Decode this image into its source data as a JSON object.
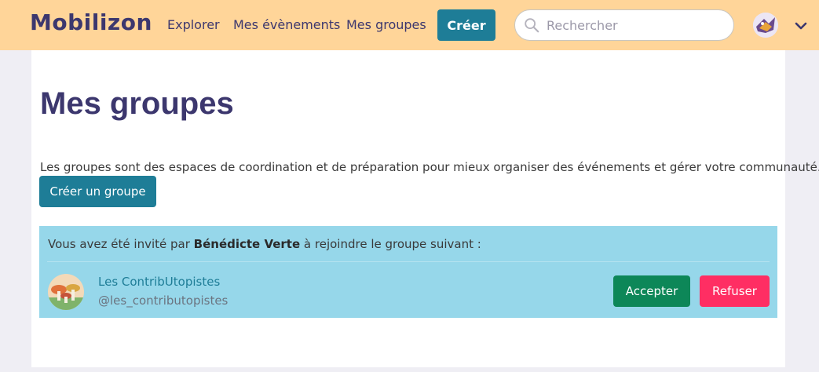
{
  "navbar": {
    "logo": "Mobilizon",
    "links": [
      "Explorer",
      "Mes évènements",
      "Mes groupes"
    ],
    "create_label": "Créer",
    "search_placeholder": "Rechercher"
  },
  "page": {
    "title": "Mes groupes",
    "description": "Les groupes sont des espaces de coordination et de préparation pour mieux organiser des événements et gérer votre communauté.",
    "create_group_label": "Créer un groupe"
  },
  "invitation": {
    "prefix": "Vous avez été invité par ",
    "inviter": "Bénédicte Verte",
    "suffix": " à rejoindre le groupe suivant :",
    "group_name": "Les ContribUtopistes",
    "group_handle": "@les_contributopistes",
    "accept_label": "Accepter",
    "reject_label": "Refuser"
  },
  "colors": {
    "navbar_bg": "#ffd599",
    "primary": "#1e7d97",
    "invite_bg": "#96d7ea",
    "success": "#0d8758",
    "danger": "#ff2e63",
    "title": "#3c376e"
  }
}
